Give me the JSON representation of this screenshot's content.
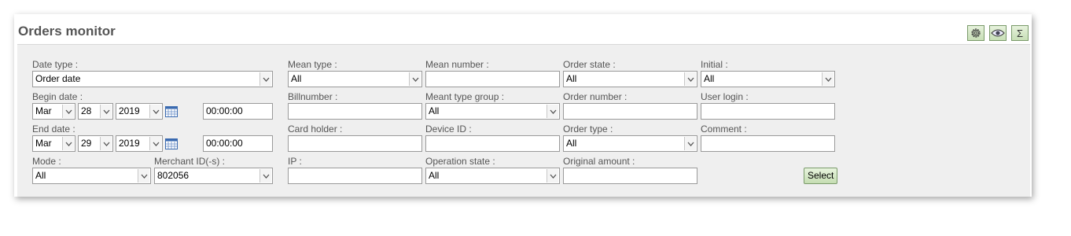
{
  "title": "Orders monitor",
  "toolbar": {
    "settings_icon": "gear-icon",
    "view_icon": "eye-icon",
    "sum_icon": "sum-icon",
    "sum_glyph": "Σ"
  },
  "labels": {
    "date_type": "Date type :",
    "begin_date": "Begin date :",
    "end_date": "End date :",
    "mode": "Mode :",
    "merchant_ids": "Merchant ID(-s) :",
    "mean_type": "Mean type :",
    "billnumber": "Billnumber :",
    "card_holder": "Card holder :",
    "ip": "IP :",
    "mean_number": "Mean number :",
    "meant_type_group": "Meant type group :",
    "device_id": "Device ID :",
    "operation_state": "Operation state :",
    "order_state": "Order state :",
    "order_number": "Order number :",
    "order_type": "Order type :",
    "original_amount": "Original amount :",
    "initial": "Initial :",
    "user_login": "User login :",
    "comment": "Comment :"
  },
  "values": {
    "date_type": "Order date",
    "begin_month": "Mar",
    "begin_day": "28",
    "begin_year": "2019",
    "begin_time": "00:00:00",
    "end_month": "Mar",
    "end_day": "29",
    "end_year": "2019",
    "end_time": "00:00:00",
    "mode": "All",
    "merchant_ids": "802056",
    "mean_type": "All",
    "billnumber": "",
    "card_holder": "",
    "ip": "",
    "mean_number": "",
    "meant_type_group": "All",
    "device_id": "",
    "operation_state": "All",
    "order_state": "All",
    "order_number": "",
    "order_type": "All",
    "original_amount": "",
    "initial": "All",
    "user_login": "",
    "comment": ""
  },
  "buttons": {
    "select": "Select"
  },
  "colors": {
    "button_green": "#c5ddb2",
    "form_bg": "#efefef"
  }
}
